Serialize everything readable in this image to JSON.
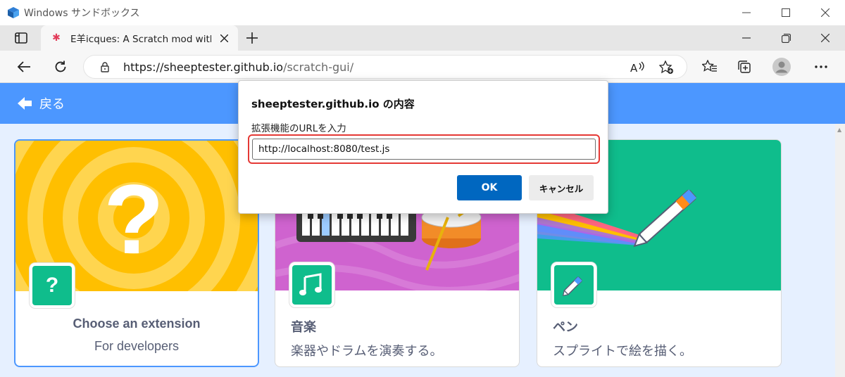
{
  "sandbox": {
    "title": "Windows サンドボックス"
  },
  "tab": {
    "title": "E羊icques: A Scratch mod with a"
  },
  "address": {
    "host": "https://sheeptester.github.io",
    "path": "/scratch-gui/"
  },
  "header": {
    "back_label": "戻る"
  },
  "cards": [
    {
      "title": "Choose an extension",
      "subtitle": "For developers",
      "icon": "question-icon"
    },
    {
      "title": "音楽",
      "subtitle": "楽器やドラムを演奏する。",
      "icon": "music-note-icon"
    },
    {
      "title": "ペン",
      "subtitle": "スプライトで絵を描く。",
      "icon": "pen-icon"
    }
  ],
  "dialog": {
    "title": "sheeptester.github.io の内容",
    "message": "拡張機能のURLを入力",
    "input_value": "http://localhost:8080/test.js",
    "ok_label": "OK",
    "cancel_label": "キャンセル"
  },
  "colors": {
    "scratch_blue": "#4c97ff",
    "ok_blue": "#0067c0",
    "highlight_red": "#e53935",
    "extension_green": "#0fbd8c"
  }
}
